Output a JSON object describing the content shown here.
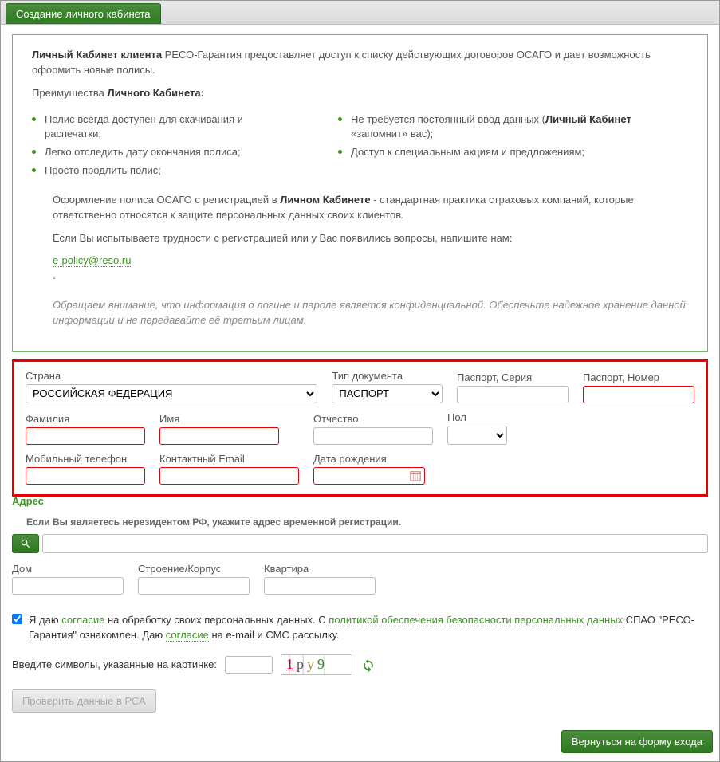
{
  "tab_title": "Создание личного кабинета",
  "info": {
    "intro_strong": "Личный Кабинет клиента",
    "intro_rest": " РЕСО-Гарантия предоставляет доступ к списку действующих договоров ОСАГО и дает возможность оформить новые полисы.",
    "adv_label_prefix": "Преимущества ",
    "adv_label_strong": "Личного Кабинета:",
    "benefits_left": [
      "Полис всегда доступен для скачивания и распечатки;",
      "Легко отследить дату окончания полиса;",
      "Просто продлить полис;"
    ],
    "benefits_right_1a": "Не требуется постоянный ввод данных (",
    "benefits_right_1b": "Личный Кабинет",
    "benefits_right_1c": " «запомнит» вас);",
    "benefits_right_2": "Доступ к специальным акциям и предложениям;",
    "para2a": "Оформление полиса ОСАГО с регистрацией в ",
    "para2b": "Личном Кабинете",
    "para2c": " - стандартная практика страховых компаний, которые ответственно относятся к защите персональных данных своих клиентов.",
    "para3": "Если Вы испытываете трудности с регистрацией или у Вас появились вопросы, напишите нам:",
    "email": "e-policy@reso.ru",
    "italic": "Обращаем внимание, что информация о логине и пароле является конфиденциальной. Обеспечьте надежное хранение данной информации и не передавайте её третьим лицам."
  },
  "form": {
    "country_label": "Страна",
    "country_value": "РОССИЙСКАЯ ФЕДЕРАЦИЯ",
    "doctype_label": "Тип документа",
    "doctype_value": "ПАСПОРТ",
    "series_label": "Паспорт, Серия",
    "number_label": "Паспорт, Номер",
    "lastname_label": "Фамилия",
    "firstname_label": "Имя",
    "middlename_label": "Отчество",
    "gender_label": "Пол",
    "phone_label": "Мобильный телефон",
    "email_label": "Контактный Email",
    "dob_label": "Дата рождения"
  },
  "address": {
    "section": "Адрес",
    "hint": "Если Вы являетесь нерезидентом РФ, укажите адрес временной регистрации.",
    "house_label": "Дом",
    "building_label": "Строение/Корпус",
    "apt_label": "Квартира"
  },
  "consent": {
    "t1": "Я даю ",
    "link1": "согласие",
    "t2": " на обработку своих персональных данных. С ",
    "link2": "политикой обеспечения безопасности персональных данных",
    "t3": " СПАО \"РЕСО-Гарантия\" ознакомлен. Даю ",
    "link3": "согласие",
    "t4": " на e-mail и СМС рассылку."
  },
  "captcha": {
    "label": "Введите символы, указанные на картинке:",
    "chars": [
      "1",
      "p",
      "y",
      "9"
    ]
  },
  "buttons": {
    "check": "Проверить данные в РСА",
    "back": "Вернуться на форму входа"
  }
}
